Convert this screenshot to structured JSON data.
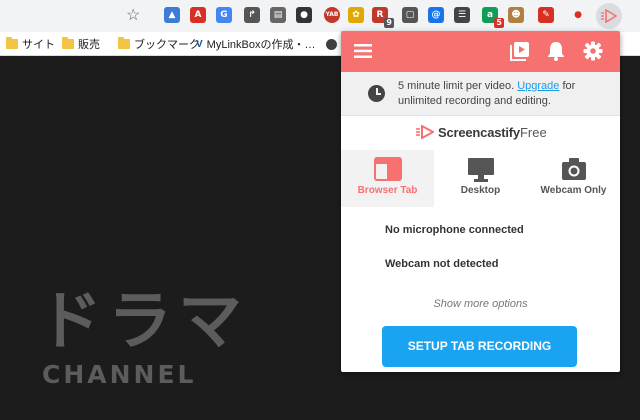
{
  "browser": {
    "bookmarks": [
      {
        "label": "サイト"
      },
      {
        "label": "販売"
      },
      {
        "label": "ブックマーク"
      },
      {
        "label": "MyLinkBoxの作成・…"
      },
      {
        "label": ""
      }
    ],
    "extensions": [
      {
        "icon": "azure-icon",
        "color": "#3c7bd6",
        "text": "▲"
      },
      {
        "icon": "pdf-icon",
        "color": "#d93025",
        "text": "A"
      },
      {
        "icon": "translate-icon",
        "color": "#4285f4",
        "text": "G"
      },
      {
        "icon": "arrow-tool-icon",
        "color": "#555555",
        "text": "↱"
      },
      {
        "icon": "note-icon",
        "color": "#666666",
        "text": "▤"
      },
      {
        "icon": "eyes-icon",
        "color": "#333333",
        "text": "●"
      },
      {
        "icon": "yab-icon",
        "color": "#c0392b",
        "text": "YAB"
      },
      {
        "icon": "bug-icon",
        "color": "#e0a800",
        "text": "✿"
      },
      {
        "icon": "r-icon",
        "color": "#c0392b",
        "text": "R",
        "badge": "9"
      },
      {
        "icon": "pocket-icon",
        "color": "#555555",
        "text": "▢"
      },
      {
        "icon": "at-icon",
        "color": "#1a73e8",
        "text": "@"
      },
      {
        "icon": "checklist-icon",
        "color": "#444444",
        "text": "☰"
      },
      {
        "icon": "a-badge-icon",
        "color": "#0f9d58",
        "text": "a",
        "badge": "5"
      },
      {
        "icon": "avatar-ext-icon",
        "color": "#b08040",
        "text": "☻"
      },
      {
        "icon": "pen-icon",
        "color": "#d93025",
        "text": "✎"
      },
      {
        "icon": "record-dot-icon",
        "color": "#ffffff",
        "text": "●"
      }
    ]
  },
  "page": {
    "logo_jp": "ドラマ",
    "logo_en": "CHANNEL"
  },
  "popup": {
    "notice_text": "5 minute limit per video. ",
    "upgrade_link": "Upgrade",
    "notice_tail": " for unlimited recording and editing.",
    "brand_name": "Screencastify",
    "brand_tier": "Free",
    "modes": [
      {
        "label": "Browser Tab",
        "active": true
      },
      {
        "label": "Desktop",
        "active": false
      },
      {
        "label": "Webcam Only",
        "active": false
      }
    ],
    "mic_status": "No microphone connected",
    "webcam_status": "Webcam not detected",
    "more_options": "Show more options",
    "setup_button": "SETUP TAB RECORDING"
  },
  "colors": {
    "accent": "#f87171",
    "button": "#1aa3f0",
    "page_bg": "#1c1c1c"
  }
}
